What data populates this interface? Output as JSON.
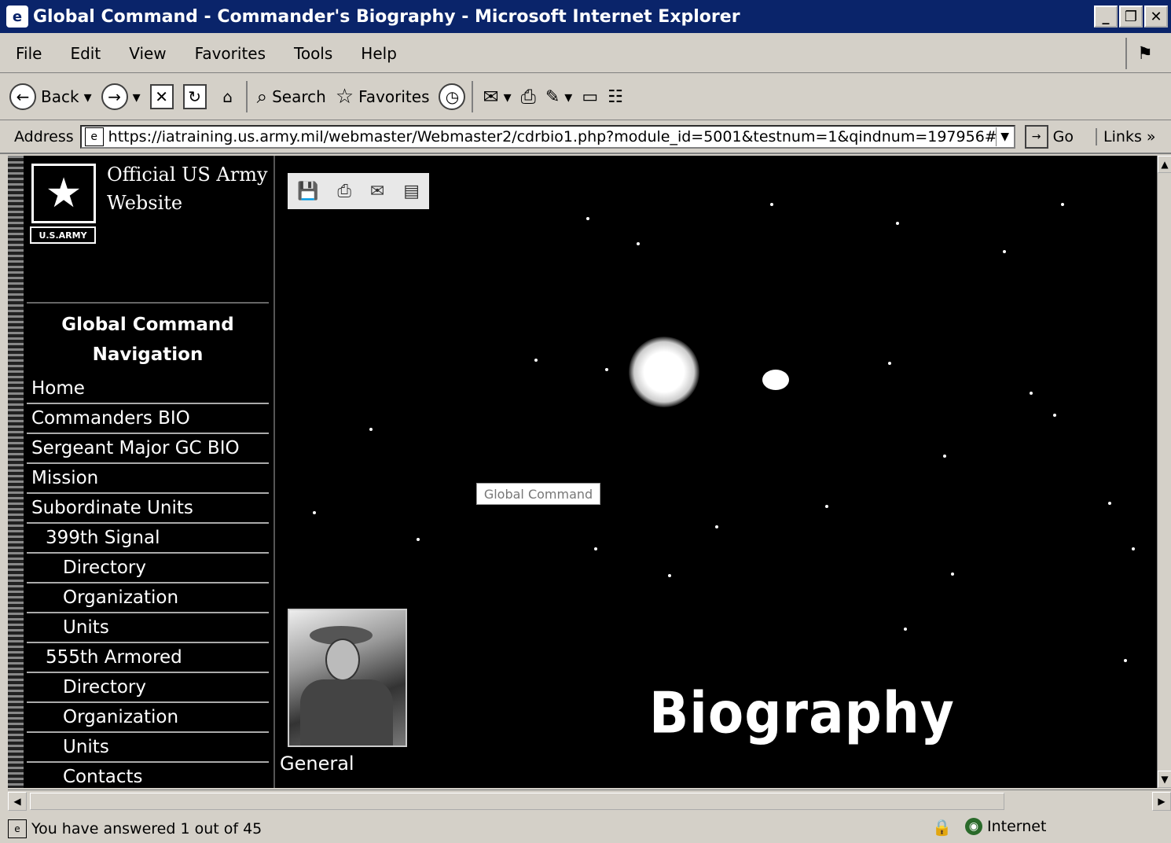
{
  "window": {
    "title": "Global Command - Commander's Biography - Microsoft Internet Explorer"
  },
  "menu": [
    "File",
    "Edit",
    "View",
    "Favorites",
    "Tools",
    "Help"
  ],
  "toolbar": {
    "back": "Back",
    "search": "Search",
    "favorites": "Favorites"
  },
  "address": {
    "label": "Address",
    "url": "https://iatraining.us.army.mil/webmaster/Webmaster2/cdrbio1.php?module_id=5001&testnum=1&qindnum=197956#",
    "go": "Go",
    "links": "Links"
  },
  "page": {
    "logo_text": "U.S.ARMY",
    "official_line1": "Official US Army",
    "official_line2": "Website",
    "nav_heading_line1": "Global Command",
    "nav_heading_line2": "Navigation",
    "nav": [
      {
        "label": "Home",
        "level": 0
      },
      {
        "label": "Commanders BIO",
        "level": 0
      },
      {
        "label": "Sergeant Major GC BIO",
        "level": 0
      },
      {
        "label": "Mission",
        "level": 0
      },
      {
        "label": "Subordinate Units",
        "level": 0
      },
      {
        "label": "399th Signal",
        "level": 1
      },
      {
        "label": "Directory",
        "level": 2
      },
      {
        "label": "Organization",
        "level": 2
      },
      {
        "label": "Units",
        "level": 2
      },
      {
        "label": "555th Armored",
        "level": 1
      },
      {
        "label": "Directory",
        "level": 2
      },
      {
        "label": "Organization",
        "level": 2
      },
      {
        "label": "Units",
        "level": 2
      },
      {
        "label": "Contacts",
        "level": 2
      }
    ],
    "global_command_label": "Global Command",
    "portrait_caption": "General",
    "heading": "Biography"
  },
  "status": {
    "text": "You have answered 1 out of 45",
    "zone": "Internet"
  }
}
